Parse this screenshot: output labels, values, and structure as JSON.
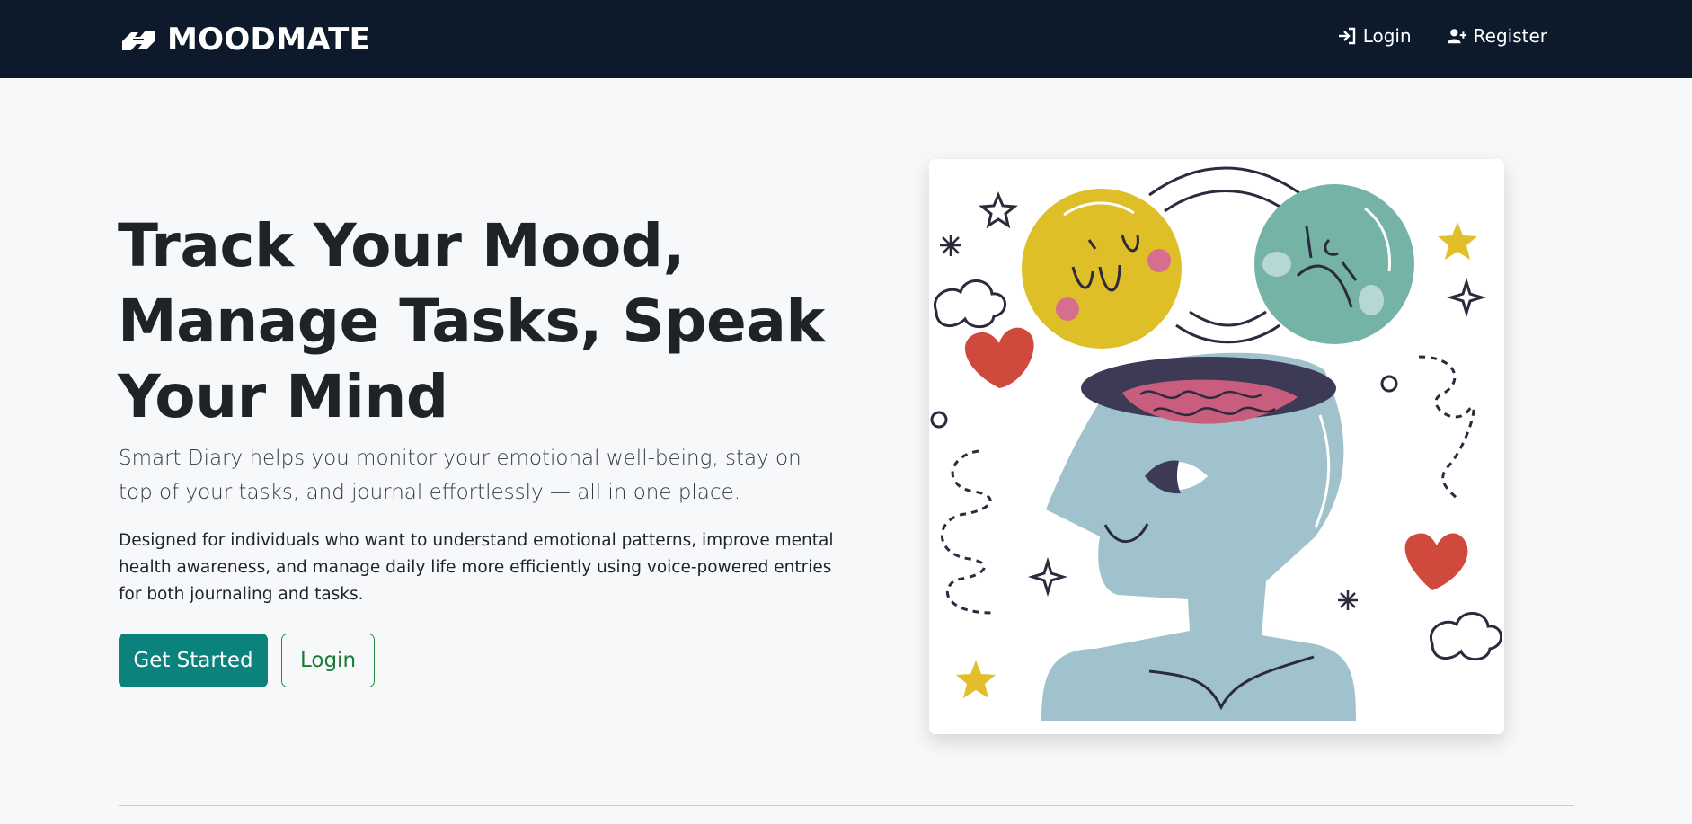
{
  "navbar": {
    "brand_name": "MOODMATE",
    "brand_icon": "handshake-icon",
    "links": [
      {
        "label": "Login",
        "icon": "sign-in-icon"
      },
      {
        "label": "Register",
        "icon": "user-plus-icon"
      }
    ]
  },
  "hero": {
    "title": "Track Your Mood, Manage Tasks, Speak Your Mind",
    "lead": "Smart Diary helps you monitor your emotional well-being, stay on top of your tasks, and journal effortlessly — all in one place.",
    "description": "Designed for individuals who want to understand emotional patterns, improve mental health awareness, and manage daily life more efficiently using voice-powered entries for both journaling and tasks.",
    "primary_button": "Get Started",
    "secondary_button": "Login"
  },
  "illustration": {
    "icon": "mental-health-head-illustration"
  },
  "colors": {
    "navbar_bg": "#0d1a2b",
    "primary": "#0b827c",
    "outline": "#2b8a44",
    "page_bg": "#f7f8fa"
  }
}
